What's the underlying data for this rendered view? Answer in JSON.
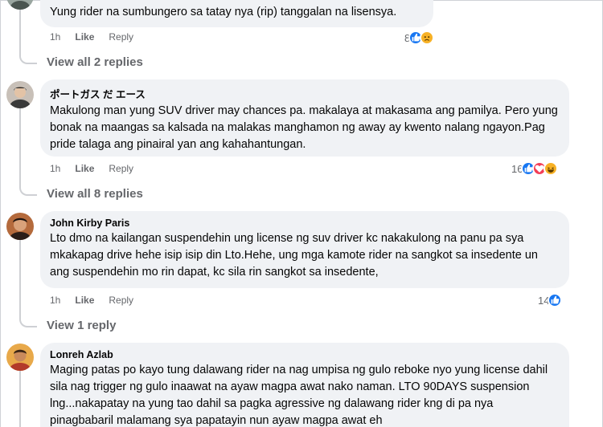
{
  "comments": [
    {
      "author": "",
      "text": "Yung rider na sumbungero sa tatay nya (rip) tanggalan na lisensya.",
      "time": "1h",
      "like": "Like",
      "reply": "Reply",
      "reaction_count": "8",
      "reactions": [
        "like-reaction",
        "sad-reaction"
      ],
      "view_replies": "View all 2 replies"
    },
    {
      "author": "ポートガス だ エース",
      "text": "Makulong man yung SUV driver may chances pa. makalaya at makasama ang pamilya. Pero yung bonak na maangas sa kalsada na malakas manghamon ng away ay kwento nalang ngayon.Pag pride talaga ang pinairal yan ang kahahantungan.",
      "time": "1h",
      "like": "Like",
      "reply": "Reply",
      "reaction_count": "16",
      "reactions": [
        "like-reaction",
        "love-reaction",
        "haha-reaction"
      ],
      "view_replies": "View all 8 replies"
    },
    {
      "author": "John Kirby Paris",
      "text": "Lto dmo na kailangan suspendehin ung license ng suv driver kc nakakulong na panu pa sya mkakapag drive hehe isip isip din Lto.Hehe, ung mga kamote rider na sangkot sa insedente un ang suspendehin mo rin dapat, kc sila rin sangkot sa insedente,",
      "time": "1h",
      "like": "Like",
      "reply": "Reply",
      "reaction_count": "14",
      "reactions": [
        "like-reaction"
      ],
      "view_replies": "View 1 reply"
    },
    {
      "author": "Lonreh Azlab",
      "text": "Maging patas po kayo tung dalawang rider na nag umpisa ng gulo reboke nyo yung license dahil sila nag trigger ng gulo inaawat na ayaw magpa awat nako naman. LTO 90DAYS suspension lng...nakapatay na yung tao dahil sa pagka agressive ng dalawang rider kng di pa nya pinagbabaril malamang sya papatayin nun ayaw magpa awat eh"
    }
  ],
  "colors": {
    "bubble": "#f0f2f5",
    "secondary_text": "#65676b",
    "like_blue": "#1877f2",
    "love_red": "#f33e58",
    "emoji_yellow": "#f7b125"
  }
}
